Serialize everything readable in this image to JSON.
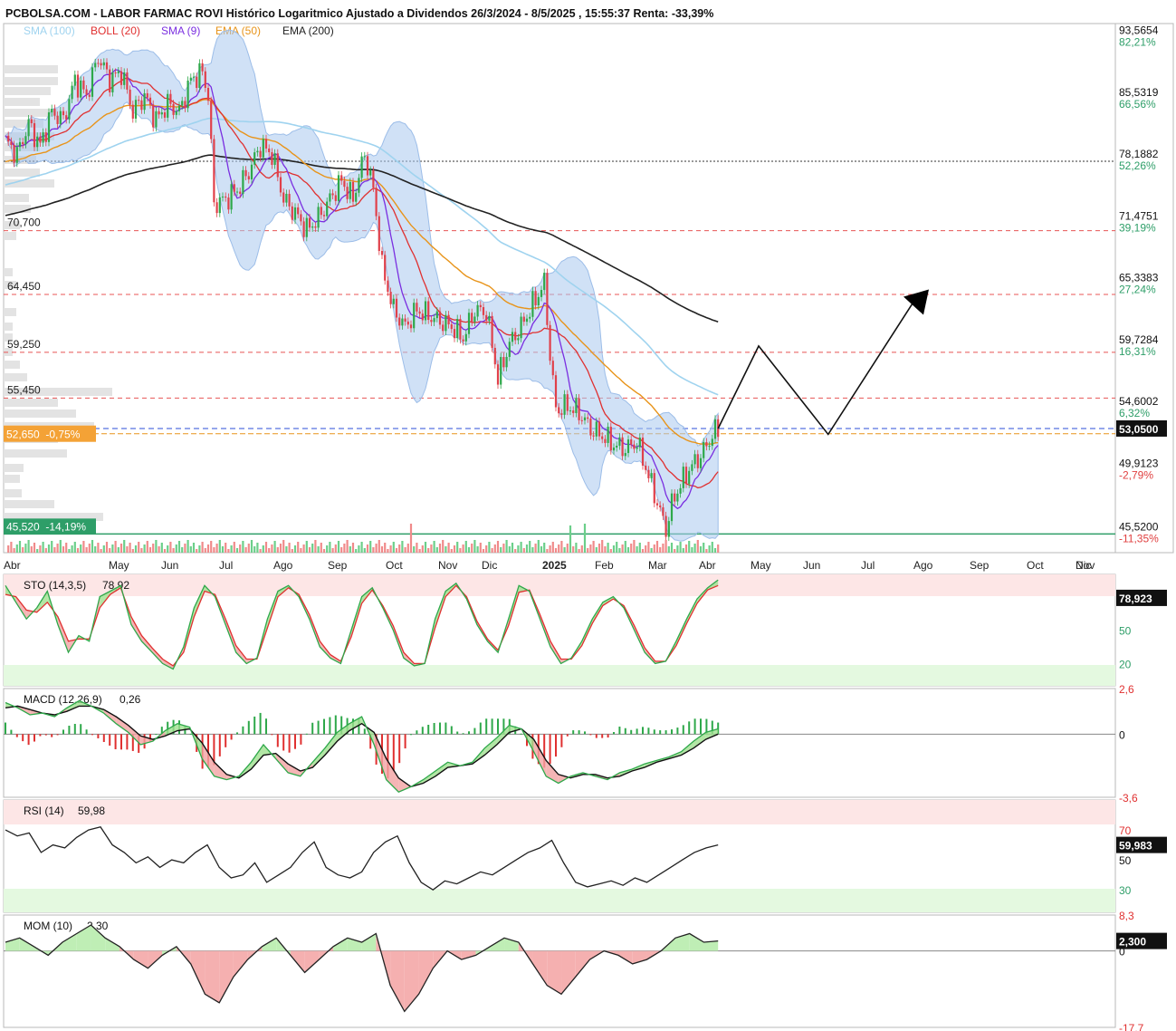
{
  "header": {
    "title": "PCBOLSA.COM - LABOR FARMAC ROVI Histórico Logaritmico Ajustado a Dividendos 26/3/2024 - 8/5/2025 , 15:55:37 Renta: -33,39%",
    "legend": [
      {
        "label": "SMA (100)",
        "color": "#9fd3ef"
      },
      {
        "label": "BOLL (20)",
        "color": "#e03030"
      },
      {
        "label": "SMA (9)",
        "color": "#7a2ee0"
      },
      {
        "label": "EMA (50)",
        "color": "#e8941a"
      },
      {
        "label": "EMA (200)",
        "color": "#222222"
      }
    ]
  },
  "chart_data": [
    {
      "id": "price",
      "type": "line",
      "title": "LABOR FARMAC ROVI",
      "scale": "log",
      "ylim": [
        44.3,
        95.5
      ],
      "x_months": [
        "Abr",
        "May",
        "Jun",
        "Jul",
        "Ago",
        "Sep",
        "Oct",
        "Nov",
        "Dic",
        "2025",
        "Feb",
        "Mar",
        "Abr",
        "May",
        "Jun",
        "Jul",
        "Ago",
        "Sep",
        "Oct",
        "Nov",
        "Dic"
      ],
      "right_axis_ticks": [
        {
          "value": 93.5654,
          "label": "93,5654",
          "pct": "82,21%"
        },
        {
          "value": 85.5319,
          "label": "85,5319",
          "pct": "66,56%"
        },
        {
          "value": 78.1882,
          "label": "78,1882",
          "pct": "52,26%"
        },
        {
          "value": 71.4751,
          "label": "71,4751",
          "pct": "39,19%"
        },
        {
          "value": 65.3383,
          "label": "65,3383",
          "pct": "27,24%"
        },
        {
          "value": 59.7284,
          "label": "59,7284",
          "pct": "16,31%"
        },
        {
          "value": 54.6002,
          "label": "54,6002",
          "pct": "6,32%"
        },
        {
          "value": 49.9123,
          "label": "49,9123",
          "pct": "-2,79%"
        },
        {
          "value": 45.52,
          "label": "45,5200",
          "pct": "-11,35%"
        }
      ],
      "current_price": {
        "value": 53.05,
        "label": "53,0500"
      },
      "support_levels": [
        {
          "value": 70.7,
          "label": "70,700"
        },
        {
          "value": 64.45,
          "label": "64,450"
        },
        {
          "value": 59.25,
          "label": "59,250"
        },
        {
          "value": 55.45,
          "label": "55,450"
        }
      ],
      "reference_line": {
        "value": 78.1882
      },
      "orange_marker": {
        "value": 52.65,
        "label": "52,650  -0,75%"
      },
      "green_marker": {
        "value": 45.52,
        "label": "45,520  -14,19%"
      },
      "close_series": [
        [
          0,
          80.5
        ],
        [
          4,
          79
        ],
        [
          8,
          82.5
        ],
        [
          12,
          80
        ],
        [
          16,
          84
        ],
        [
          20,
          83
        ],
        [
          24,
          88
        ],
        [
          28,
          86
        ],
        [
          32,
          91
        ],
        [
          36,
          88
        ],
        [
          40,
          89
        ],
        [
          44,
          84
        ],
        [
          48,
          86
        ],
        [
          52,
          83
        ],
        [
          56,
          85
        ],
        [
          60,
          84
        ],
        [
          64,
          88
        ],
        [
          68,
          89
        ],
        [
          70,
          86
        ],
        [
          72,
          73.5
        ],
        [
          76,
          74
        ],
        [
          80,
          75
        ],
        [
          84,
          77
        ],
        [
          88,
          80
        ],
        [
          92,
          79
        ],
        [
          96,
          74
        ],
        [
          100,
          72.5
        ],
        [
          104,
          70.8
        ],
        [
          108,
          72
        ],
        [
          112,
          74
        ],
        [
          116,
          76
        ],
        [
          120,
          74
        ],
        [
          124,
          79
        ],
        [
          127,
          75
        ],
        [
          130,
          67
        ],
        [
          134,
          63
        ],
        [
          138,
          61.5
        ],
        [
          142,
          63
        ],
        [
          146,
          62.5
        ],
        [
          150,
          62
        ],
        [
          154,
          61.5
        ],
        [
          158,
          60.5
        ],
        [
          162,
          63
        ],
        [
          166,
          62.8
        ],
        [
          170,
          57
        ],
        [
          174,
          60
        ],
        [
          178,
          61.5
        ],
        [
          182,
          63.5
        ],
        [
          186,
          65.5
        ],
        [
          188,
          59
        ],
        [
          190,
          54.5
        ],
        [
          194,
          54.8
        ],
        [
          198,
          54.3
        ],
        [
          202,
          53
        ],
        [
          206,
          52.5
        ],
        [
          210,
          51.8
        ],
        [
          214,
          51.5
        ],
        [
          218,
          52
        ],
        [
          222,
          49.5
        ],
        [
          226,
          47
        ],
        [
          228,
          45.8
        ],
        [
          230,
          47.5
        ],
        [
          232,
          48.5
        ],
        [
          236,
          50
        ],
        [
          240,
          51
        ],
        [
          244,
          52.5
        ],
        [
          246,
          53.05
        ]
      ],
      "projection": [
        {
          "i": 246,
          "value": 53.05
        },
        {
          "i": 260,
          "value": 59.8
        },
        {
          "i": 284,
          "value": 52.6
        },
        {
          "i": 315,
          "value": 64.4
        }
      ]
    },
    {
      "id": "sto",
      "type": "line",
      "title": "STO (14,3,5)",
      "value_label": "78,92",
      "current_label": "78,923",
      "ylim": [
        0,
        100
      ],
      "levels": [
        {
          "value": 80,
          "label": ""
        },
        {
          "value": 50,
          "label": "50"
        },
        {
          "value": 20,
          "label": "20"
        }
      ],
      "k_series": [
        90,
        75,
        60,
        70,
        85,
        55,
        30,
        45,
        40,
        80,
        85,
        90,
        55,
        40,
        30,
        20,
        15,
        35,
        70,
        90,
        80,
        55,
        30,
        20,
        25,
        60,
        85,
        90,
        80,
        60,
        35,
        25,
        20,
        50,
        80,
        88,
        70,
        50,
        25,
        18,
        20,
        60,
        85,
        92,
        78,
        55,
        40,
        30,
        60,
        90,
        85,
        60,
        35,
        20,
        25,
        40,
        60,
        75,
        80,
        70,
        50,
        30,
        20,
        22,
        40,
        60,
        78,
        88,
        95
      ],
      "d_series": [
        82,
        80,
        68,
        66,
        75,
        62,
        40,
        42,
        42,
        70,
        82,
        88,
        62,
        45,
        34,
        24,
        18,
        30,
        62,
        85,
        82,
        60,
        36,
        24,
        24,
        52,
        80,
        88,
        82,
        64,
        40,
        28,
        22,
        44,
        74,
        86,
        72,
        54,
        30,
        20,
        20,
        52,
        80,
        90,
        80,
        58,
        42,
        32,
        54,
        84,
        86,
        64,
        40,
        24,
        24,
        36,
        56,
        72,
        78,
        72,
        54,
        34,
        22,
        22,
        36,
        56,
        74,
        86,
        90
      ]
    },
    {
      "id": "macd",
      "type": "line",
      "title": "MACD (12,26,9)",
      "value_label": "0,26",
      "ylim": [
        -3.6,
        2.6
      ],
      "ticks": [
        {
          "value": 2.6,
          "label": "2,6"
        },
        {
          "value": 0,
          "label": "0"
        },
        {
          "value": -3.6,
          "label": "-3,6"
        }
      ],
      "macd_series": [
        1.8,
        1.5,
        1.1,
        1.2,
        1.0,
        1.5,
        1.9,
        1.6,
        1.2,
        0.6,
        0.1,
        -0.6,
        -0.4,
        0.2,
        0.6,
        0.4,
        -1.4,
        -2.4,
        -2.6,
        -2.4,
        -1.6,
        -0.6,
        -1.4,
        -2.2,
        -2.4,
        -1.6,
        -0.8,
        0.1,
        0.6,
        1.0,
        -0.6,
        -2.6,
        -3.3,
        -3.0,
        -2.6,
        -2.1,
        -1.6,
        -1.8,
        -1.6,
        -0.8,
        -0.2,
        0.5,
        0.3,
        -1.0,
        -2.4,
        -2.8,
        -2.4,
        -2.2,
        -2.4,
        -2.6,
        -2.2,
        -2.0,
        -1.7,
        -1.5,
        -1.3,
        -1.0,
        -0.4,
        0.1,
        0.3
      ],
      "signal_series": [
        1.5,
        1.6,
        1.4,
        1.2,
        1.1,
        1.3,
        1.6,
        1.6,
        1.4,
        1.0,
        0.5,
        -0.1,
        -0.3,
        -0.1,
        0.2,
        0.3,
        -0.5,
        -1.6,
        -2.3,
        -2.5,
        -2.0,
        -1.2,
        -1.1,
        -1.7,
        -2.1,
        -1.9,
        -1.2,
        -0.4,
        0.2,
        0.6,
        0.1,
        -1.4,
        -2.5,
        -3.0,
        -2.8,
        -2.4,
        -1.9,
        -1.8,
        -1.7,
        -1.2,
        -0.6,
        0.1,
        0.3,
        -0.3,
        -1.5,
        -2.3,
        -2.5,
        -2.3,
        -2.3,
        -2.5,
        -2.4,
        -2.1,
        -1.9,
        -1.6,
        -1.4,
        -1.2,
        -0.8,
        -0.3,
        0.0
      ]
    },
    {
      "id": "rsi",
      "type": "line",
      "title": "RSI (14)",
      "value_label": "59,98",
      "current_label": "59,983",
      "ylim": [
        15,
        90
      ],
      "levels": [
        {
          "value": 70,
          "label": "70"
        },
        {
          "value": 50,
          "label": "50"
        },
        {
          "value": 30,
          "label": "30"
        }
      ],
      "series": [
        70,
        66,
        68,
        55,
        60,
        58,
        65,
        70,
        72,
        60,
        55,
        48,
        52,
        45,
        50,
        48,
        55,
        60,
        45,
        38,
        40,
        48,
        35,
        40,
        45,
        55,
        62,
        45,
        40,
        38,
        42,
        55,
        62,
        66,
        48,
        35,
        30,
        36,
        34,
        38,
        42,
        40,
        45,
        50,
        55,
        58,
        63,
        48,
        35,
        32,
        34,
        36,
        33,
        38,
        35,
        40,
        45,
        50,
        55,
        58,
        60
      ],
      "series_start_index": 0
    },
    {
      "id": "mom",
      "type": "line",
      "title": "MOM (10)",
      "value_label": "2,30",
      "current_label": "2,300",
      "ylim": [
        -17.7,
        8.3
      ],
      "ticks": [
        {
          "value": 8.3,
          "label": "8,3"
        },
        {
          "value": 0,
          "label": "0"
        },
        {
          "value": -17.7,
          "label": "-17,7"
        }
      ],
      "series": [
        2,
        3,
        1,
        -1,
        2,
        4,
        6,
        3,
        1,
        -2,
        -4,
        -1,
        1,
        -3,
        -10,
        -12,
        -6,
        -2,
        1,
        3,
        -1,
        -5,
        -2,
        1,
        3,
        2,
        4,
        -8,
        -14,
        -10,
        -4,
        0,
        -2,
        -1,
        1,
        3,
        2,
        -3,
        -8,
        -10,
        -6,
        -2,
        0,
        -1,
        -3,
        -2,
        0,
        3,
        4,
        2,
        2.3
      ]
    }
  ]
}
